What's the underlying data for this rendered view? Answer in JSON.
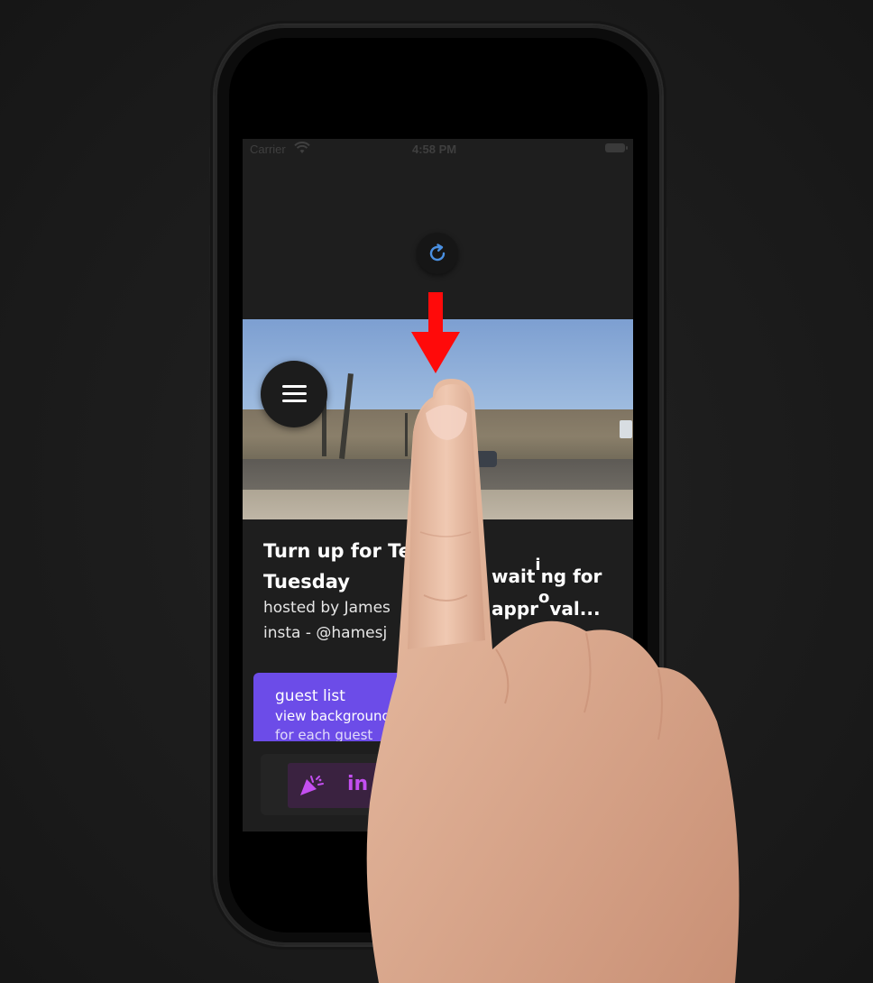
{
  "status_bar": {
    "carrier": "Carrier",
    "time": "4:58 PM"
  },
  "event": {
    "title_line1": "Turn up for Te",
    "title_line2": "Tuesday",
    "hosted_by": "hosted by James",
    "insta": "insta - @hamesj"
  },
  "status": {
    "line1_a": "wait",
    "line1_b": "i",
    "line1_c": "ng for",
    "line2_a": "appr",
    "line2_b": "o",
    "line2_c": "val..."
  },
  "guest_list": {
    "title": "guest list",
    "subtitle": "view background",
    "subtitle2": "for each guest"
  },
  "invite": {
    "label": "in"
  },
  "colors": {
    "accent_purple": "#6c4ce8",
    "invite_text": "#c34ff0",
    "spinner_blue": "#4a90e2",
    "arrow_red": "#ff0a0a"
  },
  "icons": [
    "wifi-icon",
    "battery-icon",
    "refresh-icon",
    "hamburger-menu-icon",
    "party-popper-icon",
    "down-arrow-icon"
  ]
}
